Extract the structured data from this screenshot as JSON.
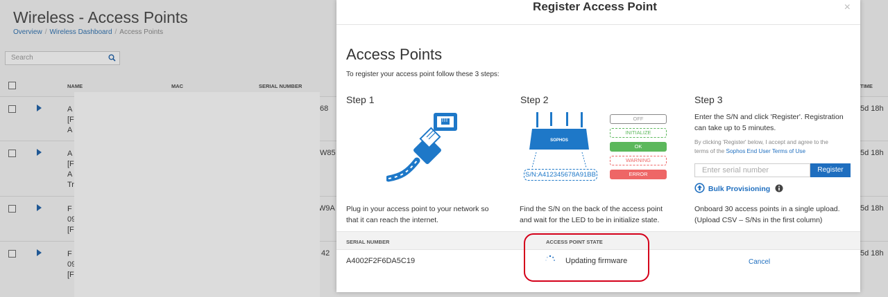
{
  "background": {
    "page_title": "Wireless - Access Points",
    "breadcrumb": [
      "Overview",
      "Wireless Dashboard",
      "Access Points"
    ],
    "search_placeholder": "Search",
    "columns": [
      "NAME",
      "MAC",
      "SERIAL NUMBER",
      "TIME"
    ],
    "rows": [
      {
        "lines": [
          "A",
          "[F",
          "A"
        ],
        "serial_tail": "68",
        "time": "5d 18h"
      },
      {
        "lines": [
          "A",
          "[F",
          "A",
          "Tr"
        ],
        "serial_tail": "W85",
        "time": "5d 18h"
      },
      {
        "lines": [
          "F",
          "09",
          "[F"
        ],
        "serial_tail": "W9A",
        "time": "5d 18h"
      },
      {
        "lines": [
          "F",
          "09",
          "[F"
        ],
        "serial_tail": "42",
        "time": "5d 18h"
      }
    ]
  },
  "modal": {
    "title": "Register Access Point",
    "close_glyph": "×",
    "heading": "Access Points",
    "subheading": "To register your access point follow these 3 steps:",
    "step1": {
      "title": "Step 1",
      "desc_line1": "Plug in your access point to your network so",
      "desc_line2": "that it can reach the internet."
    },
    "step2": {
      "title": "Step 2",
      "brand": "SOPHOS",
      "serial_label": "S/N:A412345678A91BB",
      "leds": [
        "OFF",
        "INITIALIZE",
        "OK",
        "WARNING",
        "ERROR"
      ],
      "desc_line1": "Find the S/N on the back of the access point",
      "desc_line2": "and wait for the LED to be in initialize state."
    },
    "step3": {
      "title": "Step 3",
      "desc_line1": "Enter the S/N and click 'Register'. Registration",
      "desc_line2": "can take up to 5 minutes.",
      "terms_line1": "By clicking 'Register' below, I accept and agree to the",
      "terms_line2_prefix": "terms of the ",
      "terms_link": "Sophos End User Terms of Use",
      "serial_placeholder": "Enter serial number",
      "register_label": "Register",
      "bulk_label": "Bulk Provisioning",
      "bulk_desc_line1": "Onboard 30 access points in a single upload.",
      "bulk_desc_line2": "(Upload CSV – S/Ns in the first column)"
    },
    "table": {
      "col_serial": "SERIAL NUMBER",
      "col_state": "ACCESS POINT STATE",
      "serial": "A4002F2F6DA5C19",
      "state": "Updating firmware",
      "cancel_label": "Cancel"
    }
  },
  "colors": {
    "accent": "#1e6ebf",
    "highlight": "#d4001a",
    "led_ok": "#5cb85c",
    "led_error": "#ee6666"
  }
}
